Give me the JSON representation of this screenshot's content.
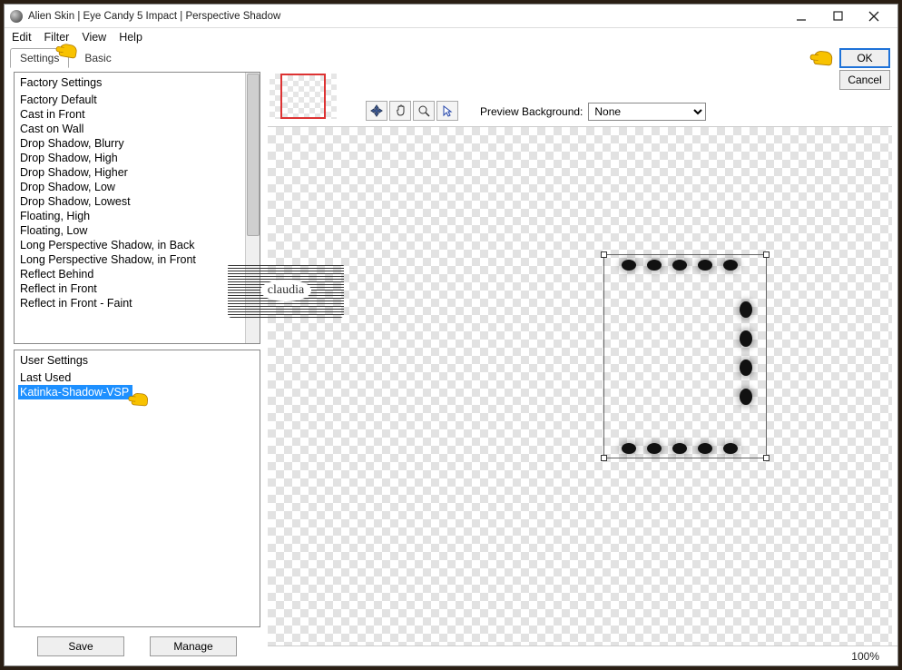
{
  "title": "Alien Skin | Eye Candy 5 Impact | Perspective Shadow",
  "menu": {
    "edit": "Edit",
    "filter": "Filter",
    "view": "View",
    "help": "Help"
  },
  "tabs": {
    "settings": "Settings",
    "basic": "Basic"
  },
  "factory": {
    "header": "Factory Settings",
    "items": [
      "Factory Default",
      "Cast in Front",
      "Cast on Wall",
      "Drop Shadow, Blurry",
      "Drop Shadow, High",
      "Drop Shadow, Higher",
      "Drop Shadow, Low",
      "Drop Shadow, Lowest",
      "Floating, High",
      "Floating, Low",
      "Long Perspective Shadow, in Back",
      "Long Perspective Shadow, in Front",
      "Reflect Behind",
      "Reflect in Front",
      "Reflect in Front - Faint"
    ]
  },
  "user": {
    "header": "User Settings",
    "lastUsed": "Last Used",
    "selected": "Katinka-Shadow-VSP"
  },
  "buttons": {
    "save": "Save",
    "manage": "Manage",
    "ok": "OK",
    "cancel": "Cancel"
  },
  "preview": {
    "label": "Preview Background:",
    "value": "None"
  },
  "watermark": "claudia",
  "zoom": "100%"
}
